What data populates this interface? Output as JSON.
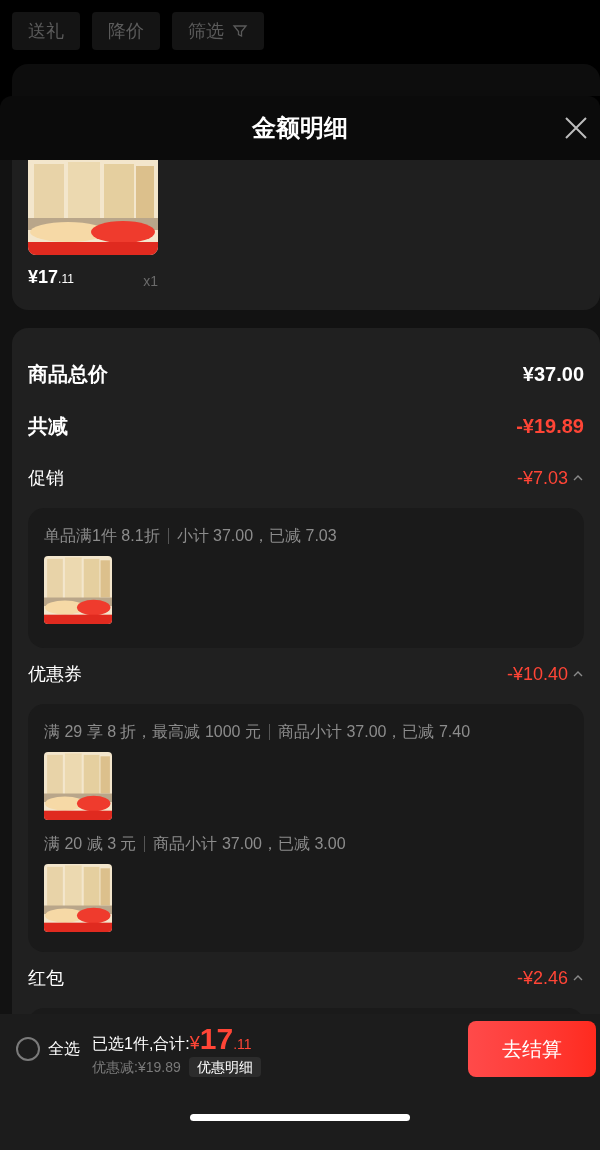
{
  "filter_chips": [
    {
      "label": "送礼",
      "icon": false
    },
    {
      "label": "降价",
      "icon": false
    },
    {
      "label": "筛选",
      "icon": true
    }
  ],
  "sheet": {
    "title": "金额明细",
    "product": {
      "price_main": "¥17",
      "price_decimal": ".11",
      "quantity": "x1"
    },
    "summary": [
      {
        "label": "商品总价",
        "amount": "¥37.00",
        "kind": "total"
      },
      {
        "label": "共减",
        "amount": "-¥19.89",
        "kind": "discount"
      }
    ],
    "sections": [
      {
        "title": "促销",
        "amount": "-¥7.03",
        "expanded": true,
        "rules": [
          {
            "text": "单品满1件 8.1折",
            "detail": "小计 37.00，已减 7.03"
          }
        ]
      },
      {
        "title": "优惠券",
        "amount": "-¥10.40",
        "expanded": true,
        "rules": [
          {
            "text": "满 29 享 8 折，最高减 1000 元",
            "detail": "商品小计 37.00，已减 7.40"
          },
          {
            "text": "满 20 减 3 元",
            "detail": "商品小计 37.00，已减 3.00"
          }
        ]
      },
      {
        "title": "红包",
        "amount": "-¥2.46",
        "expanded": true
      }
    ]
  },
  "footer": {
    "select_all": {
      "label": "全选",
      "checked": false
    },
    "selected_label": "已选1件,合计:",
    "currency": "¥",
    "total_main": "17",
    "total_decimal": ".11",
    "saving": "优惠减:¥19.89",
    "detail_button": "优惠明细",
    "checkout_button": "去结算"
  }
}
